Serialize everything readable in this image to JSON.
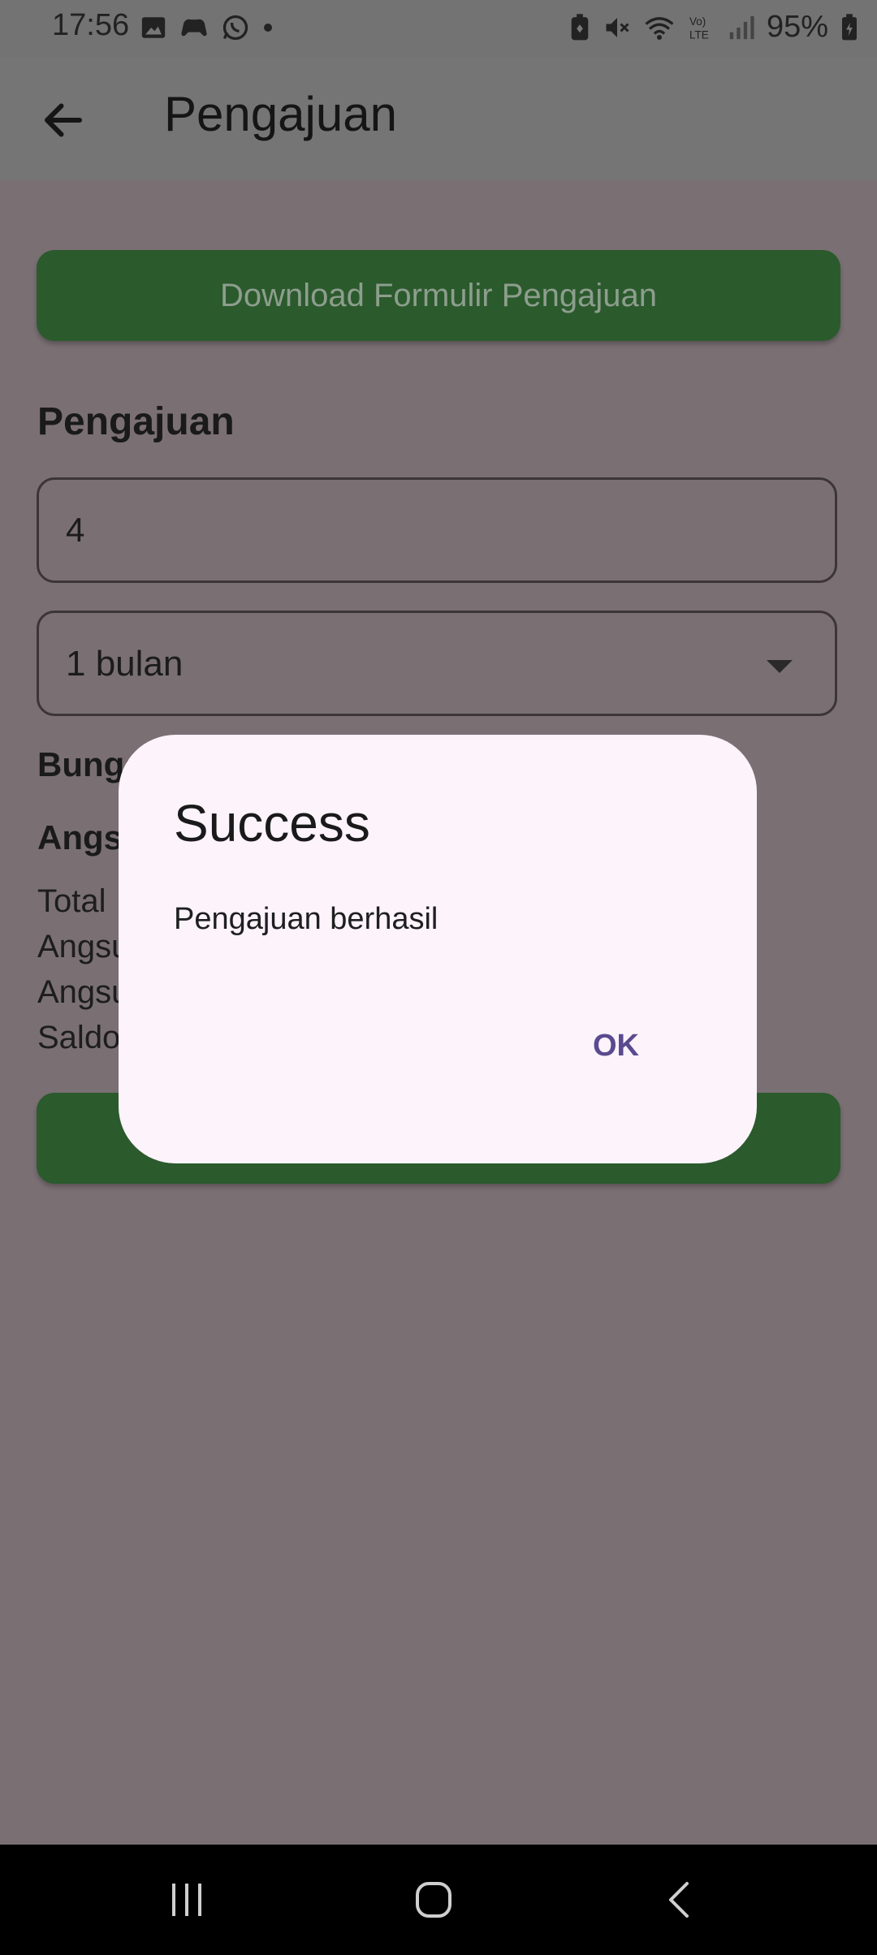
{
  "status_bar": {
    "time": "17:56",
    "battery": "95%",
    "left_icons": [
      "image-icon",
      "game-controller-icon",
      "whatsapp-icon",
      "dot-icon"
    ],
    "right_icons": [
      "battery-saver-icon",
      "mute-icon",
      "wifi-icon",
      "volte-icon",
      "signal-icon",
      "battery-charging-icon"
    ]
  },
  "app_bar": {
    "title": "Pengajuan",
    "back_icon": "arrow-left-icon"
  },
  "form": {
    "download_button_label": "Download Formulir Pengajuan",
    "section_title": "Pengajuan",
    "amount_value": "4",
    "duration_value": "1 bulan",
    "bunga_label": "Bunga",
    "angsuran_title": "Angs",
    "summary_lines": [
      "Total",
      "Angsu",
      "Angsu",
      "Saldo"
    ]
  },
  "dialog": {
    "title": "Success",
    "message": "Pengajuan berhasil",
    "ok_label": "OK"
  },
  "colors": {
    "primary_green": "#2b5a2d",
    "dialog_bg": "#fcf3fb",
    "dialog_action": "#5a4a8f",
    "scrim": "#7a7074"
  }
}
